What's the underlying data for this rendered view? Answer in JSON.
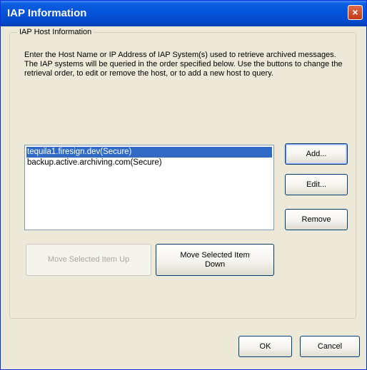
{
  "window": {
    "title": "IAP Information",
    "close_glyph": "×"
  },
  "group": {
    "title": "IAP Host Information",
    "intro": "Enter the Host Name or IP Address of IAP System(s) used  to retrieve archived messages. The IAP systems will be queried in the order specified below. Use the buttons to change the retrieval order, to edit or remove the host, or to add a new host to query."
  },
  "hosts": [
    {
      "label": "tequila1.firesign.dev(Secure)",
      "selected": true
    },
    {
      "label": "backup.active.archiving.com(Secure)",
      "selected": false
    }
  ],
  "buttons": {
    "add": "Add...",
    "edit": "Edit...",
    "remove": "Remove",
    "move_up": "Move Selected Item Up",
    "move_down": "Move Selected Item Down",
    "ok": "OK",
    "cancel": "Cancel"
  },
  "colors": {
    "titlebar": "#0453d8",
    "selection": "#316ac5",
    "dialog_bg": "#ece9d8"
  }
}
